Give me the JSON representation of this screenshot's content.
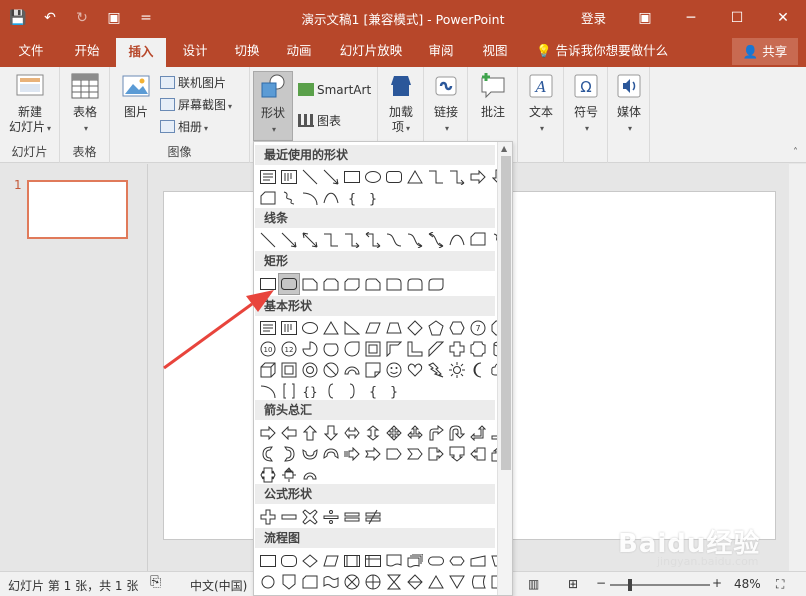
{
  "titlebar": {
    "title": "演示文稿1 [兼容模式] - PowerPoint",
    "login": "登录",
    "minimize": "─",
    "restore": "☐",
    "close": "✕"
  },
  "qat": {
    "save": "💾",
    "undo": "↶",
    "redo": "↻",
    "present": "▣",
    "customize": "="
  },
  "tabs": [
    "文件",
    "开始",
    "插入",
    "设计",
    "切换",
    "动画",
    "幻灯片放映",
    "审阅",
    "视图"
  ],
  "tellme": "告诉我你想要做什么",
  "share": "共享",
  "ribbon": {
    "new_slide": "新建\n幻灯片",
    "tables": "表格",
    "images": "图片",
    "online_pictures": "联机图片",
    "screenshot": "屏幕截图",
    "album": "相册",
    "shapes": "形状",
    "smartart": "SmartArt",
    "chart": "图表",
    "addins": "加载\n项",
    "links": "链接",
    "comment": "批注",
    "text": "文本",
    "symbols": "符号",
    "media": "媒体",
    "groups": {
      "slides": "幻灯片",
      "tables": "表格",
      "images": "图像"
    }
  },
  "gallery": {
    "recent": "最近使用的形状",
    "lines": "线条",
    "rect": "矩形",
    "basic": "基本形状",
    "arrows": "箭头总汇",
    "equation": "公式形状",
    "flow": "流程图"
  },
  "slide_number": "1",
  "status": {
    "slide_info": "幻灯片 第 1 张，共 1 张",
    "language": "中文(中国)",
    "zoom": "48%"
  },
  "watermark": {
    "main": "Baidu经验",
    "sub": "jingyan.baidu.com"
  },
  "colors": {
    "accent": "#b7472a",
    "arrow": "#e8443c"
  }
}
